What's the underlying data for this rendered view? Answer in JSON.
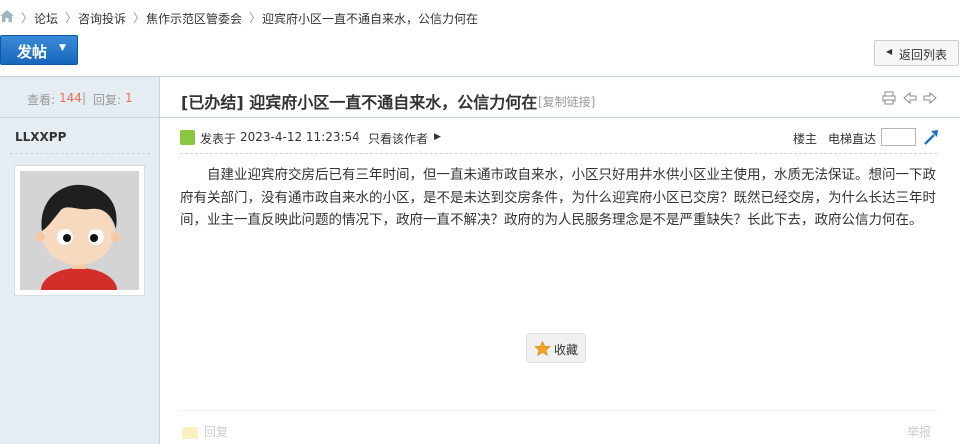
{
  "breadcrumb": {
    "items": [
      "论坛",
      "咨询投诉",
      "焦作示范区管委会",
      "迎宾府小区一直不通自来水，公信力何在"
    ]
  },
  "toolbar": {
    "post_label": "发帖",
    "back_label": "返回列表"
  },
  "thread": {
    "views_label": "查看:",
    "views": "144",
    "replies_label": "回复:",
    "replies": "1",
    "status_tag": "[已办结]",
    "title": "迎宾府小区一直不通自来水，公信力何在",
    "copy_link": "[复制链接]"
  },
  "post": {
    "author": "LLXXPP",
    "posted_label": "发表于",
    "posted_time": "2023-4-12 11:23:54",
    "only_author": "只看该作者",
    "floor_label": "楼主",
    "jump_label": "电梯直达",
    "content": "自建业迎宾府交房后已有三年时间，但一直未通市政自来水，小区只好用井水供小区业主使用，水质无法保证。想问一下政府有关部门，没有通市政自来水的小区，是不是未达到交房条件，为什么迎宾府小区已交房？既然已经交房，为什么长达三年时间，业主一直反映此问题的情况下，政府一直不解决？政府的为人民服务理念是不是严重缺失？长此下去，政府公信力何在。",
    "favorite_label": "收藏",
    "reply_label": "回复",
    "report_label": "举报"
  },
  "colors": {
    "accent": "#1667bd",
    "count": "#f26c4f",
    "sidebar": "#e5edf2",
    "border": "#c2d5e3"
  }
}
